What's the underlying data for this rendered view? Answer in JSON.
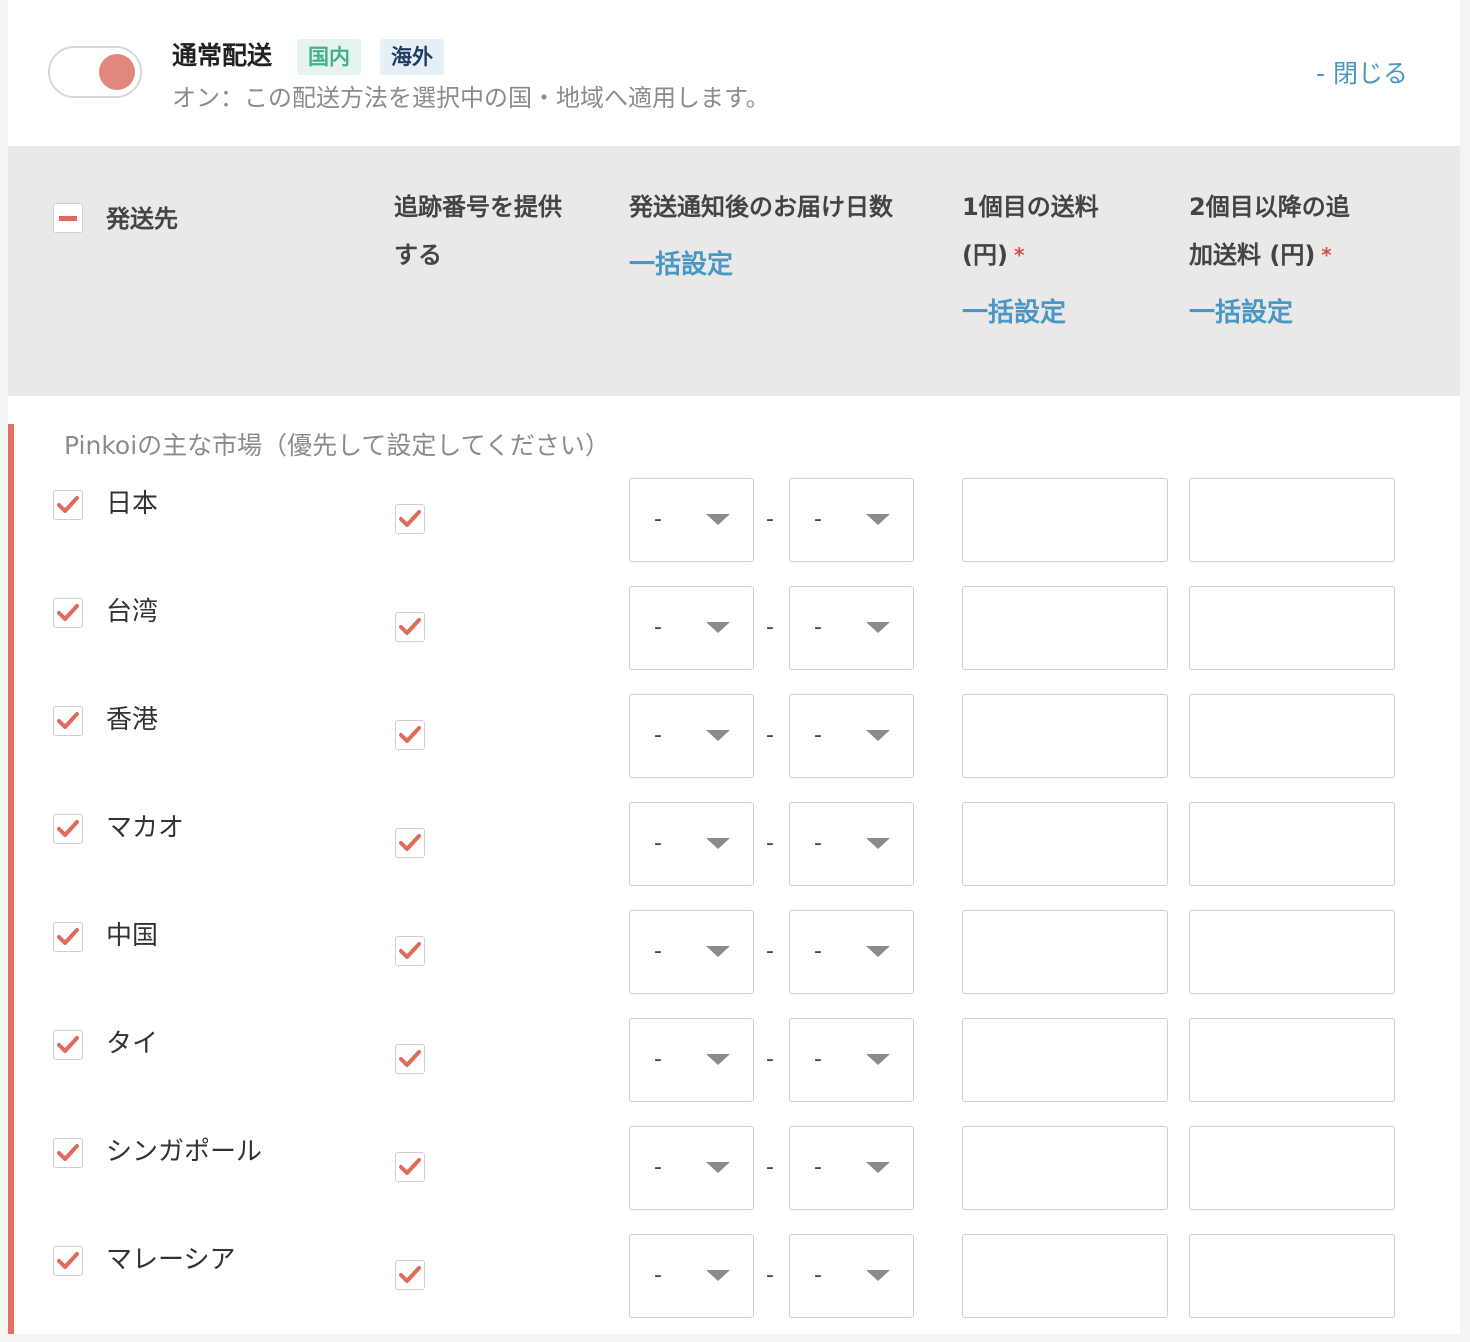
{
  "method": {
    "title": "通常配送",
    "badges": {
      "domestic": "国内",
      "overseas": "海外"
    },
    "description": "オン：この配送方法を選択中の国・地域へ適用します。",
    "enabled": true,
    "close_label": "- 閉じる"
  },
  "table_header": {
    "destination": "発送先",
    "tracking_line1": "追跡番号を提供",
    "tracking_line2": "する",
    "delivery_days": "発送通知後のお届け日数",
    "first_fee_line1": "1個目の送料",
    "first_fee_line2": "(円)",
    "additional_fee_line1": "2個目以降の追",
    "additional_fee_line2": "加送料 (円)",
    "required_mark": "*",
    "bulk_setting": "一括設定"
  },
  "group_label": "Pinkoiの主な市場（優先して設定してください）",
  "range_separator": "-",
  "select_default": "-",
  "countries": [
    {
      "name": "日本",
      "checked": true,
      "tracking": true,
      "days_from": "-",
      "days_to": "-",
      "first_fee": "",
      "additional_fee": ""
    },
    {
      "name": "台湾",
      "checked": true,
      "tracking": true,
      "days_from": "-",
      "days_to": "-",
      "first_fee": "",
      "additional_fee": ""
    },
    {
      "name": "香港",
      "checked": true,
      "tracking": true,
      "days_from": "-",
      "days_to": "-",
      "first_fee": "",
      "additional_fee": ""
    },
    {
      "name": "マカオ",
      "checked": true,
      "tracking": true,
      "days_from": "-",
      "days_to": "-",
      "first_fee": "",
      "additional_fee": ""
    },
    {
      "name": "中国",
      "checked": true,
      "tracking": true,
      "days_from": "-",
      "days_to": "-",
      "first_fee": "",
      "additional_fee": ""
    },
    {
      "name": "タイ",
      "checked": true,
      "tracking": true,
      "days_from": "-",
      "days_to": "-",
      "first_fee": "",
      "additional_fee": ""
    },
    {
      "name": "シンガポール",
      "checked": true,
      "tracking": true,
      "days_from": "-",
      "days_to": "-",
      "first_fee": "",
      "additional_fee": ""
    },
    {
      "name": "マレーシア",
      "checked": true,
      "tracking": true,
      "days_from": "-",
      "days_to": "-",
      "first_fee": "",
      "additional_fee": ""
    }
  ],
  "colors": {
    "accent_red": "#e0695c",
    "link_blue": "#4a97c5",
    "header_bg": "#ebe9e8",
    "domestic_badge": "#45b088",
    "overseas_badge": "#1f3d5f"
  }
}
